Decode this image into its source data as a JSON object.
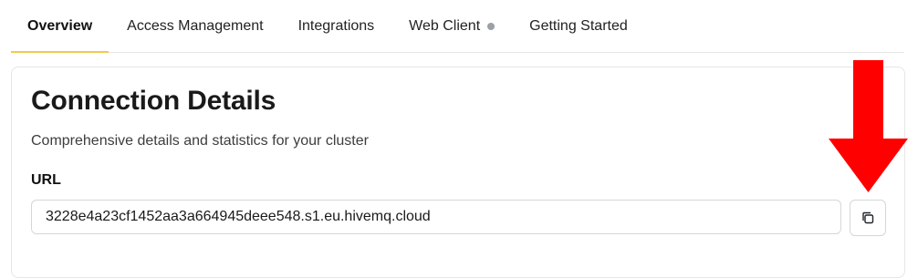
{
  "tabs": [
    {
      "label": "Overview",
      "active": true
    },
    {
      "label": "Access Management",
      "active": false
    },
    {
      "label": "Integrations",
      "active": false
    },
    {
      "label": "Web Client",
      "active": false,
      "status_dot_color": "#9aa0a6"
    },
    {
      "label": "Getting Started",
      "active": false
    }
  ],
  "section": {
    "title": "Connection Details",
    "subtitle": "Comprehensive details and statistics for your cluster",
    "url_label": "URL",
    "url_value": "3228e4a23cf1452aa3a664945deee548.s1.eu.hivemq.cloud",
    "copy_icon": "copy-icon"
  },
  "annotation": {
    "icon": "down-arrow-icon",
    "color": "#ff0000"
  },
  "colors": {
    "active_tab_underline": "#f2c94c",
    "border": "#e6e6e6"
  }
}
